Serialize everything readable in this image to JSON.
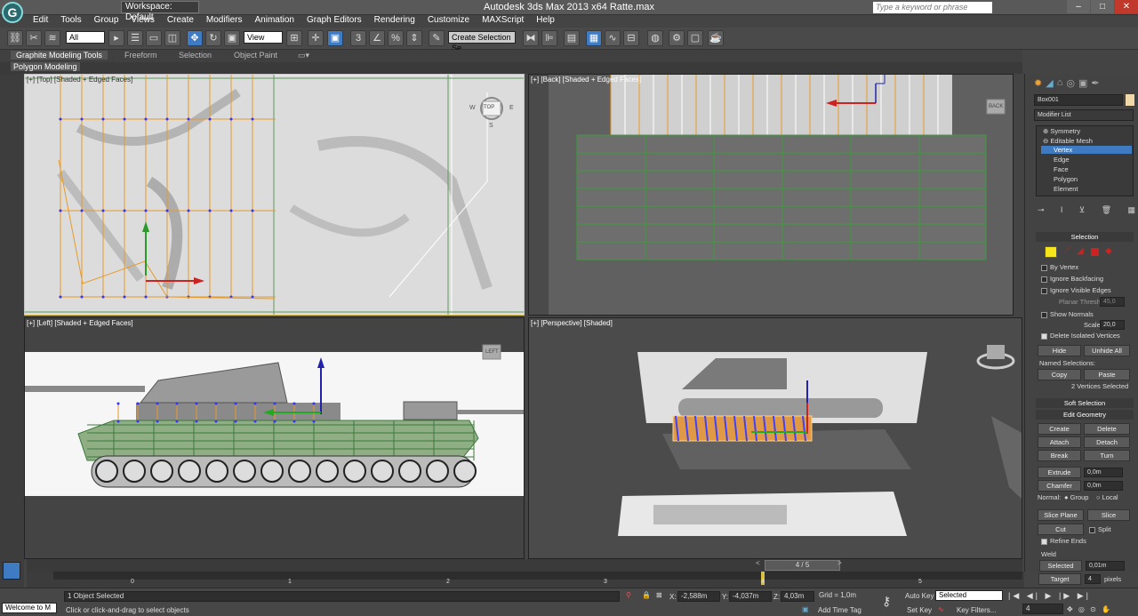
{
  "window": {
    "title": "Autodesk 3ds Max  2013 x64       Ratte.max",
    "workspace": "Workspace: Default",
    "search_placeholder": "Type a keyword or phrase"
  },
  "menu": [
    "Edit",
    "Tools",
    "Group",
    "Views",
    "Create",
    "Modifiers",
    "Animation",
    "Graph Editors",
    "Rendering",
    "Customize",
    "MAXScript",
    "Help"
  ],
  "toolbar": {
    "filter": "All",
    "ref_coord": "View",
    "named_selection": "Create Selection Se"
  },
  "ribbon": {
    "tabs": [
      "Graphite Modeling Tools",
      "Freeform",
      "Selection",
      "Object Paint"
    ],
    "panel": "Polygon Modeling"
  },
  "viewports": {
    "top_left": "[+] [Top] [Shaded + Edged Faces]",
    "top_right": "[+] [Back] [Shaded + Edged Faces]",
    "bottom_left": "[+] [Left] [Shaded + Edged Faces]",
    "bottom_right": "[+] [Perspective] [Shaded]",
    "viewcube_top": "TOP",
    "viewcube_back": "BACK",
    "viewcube_left": "LEFT",
    "compass": {
      "w": "W",
      "e": "E",
      "s": "S"
    }
  },
  "command_panel": {
    "object_name": "Box001",
    "modifier_list": "Modifier List",
    "stack": [
      "Symmetry",
      "Editable Mesh",
      "Vertex",
      "Edge",
      "Face",
      "Polygon",
      "Element"
    ],
    "selection": {
      "header": "Selection",
      "by_vertex": "By Vertex",
      "ignore_backfacing": "Ignore Backfacing",
      "ignore_visible_edges": "Ignore Visible Edges",
      "planar_thresh_label": "Planar Thresh:",
      "planar_thresh": "45,0",
      "show_normals": "Show Normals",
      "scale_label": "Scale:",
      "scale": "20,0",
      "delete_isolated": "Delete Isolated Vertices",
      "hide": "Hide",
      "unhide_all": "Unhide All",
      "named_selections": "Named Selections:",
      "copy": "Copy",
      "paste": "Paste",
      "status": "2 Vertices Selected"
    },
    "soft_selection": "Soft Selection",
    "edit_geometry": {
      "header": "Edit Geometry",
      "create": "Create",
      "delete": "Delete",
      "attach": "Attach",
      "detach": "Detach",
      "break": "Break",
      "turn": "Turn",
      "extrude": "Extrude",
      "extrude_val": "0,0m",
      "chamfer": "Chamfer",
      "chamfer_val": "0,0m",
      "normal_label": "Normal:",
      "group": "Group",
      "local": "Local",
      "slice_plane": "Slice Plane",
      "slice": "Slice",
      "cut": "Cut",
      "split": "Split",
      "refine_ends": "Refine Ends",
      "weld": "Weld",
      "selected": "Selected",
      "selected_val": "0,01m",
      "target": "Target",
      "target_val": "4",
      "pixels": "pixels"
    }
  },
  "timeline": {
    "frame": "4 / 5",
    "ticks": [
      "0",
      "1",
      "2",
      "3",
      "4",
      "5"
    ]
  },
  "status": {
    "maxscript": "Welcome to M",
    "objects": "1 Object Selected",
    "prompt": "Click or click-and-drag to select objects",
    "x_label": "X:",
    "x": "-2,588m",
    "y_label": "Y:",
    "y": "-4,037m",
    "z_label": "Z:",
    "z": "4,03m",
    "grid": "Grid = 1,0m",
    "add_time_tag": "Add Time Tag",
    "auto_key": "Auto Key",
    "set_key": "Set Key",
    "key_filter": "Selected",
    "key_filters": "Key Filters...",
    "frame_field": "4"
  }
}
